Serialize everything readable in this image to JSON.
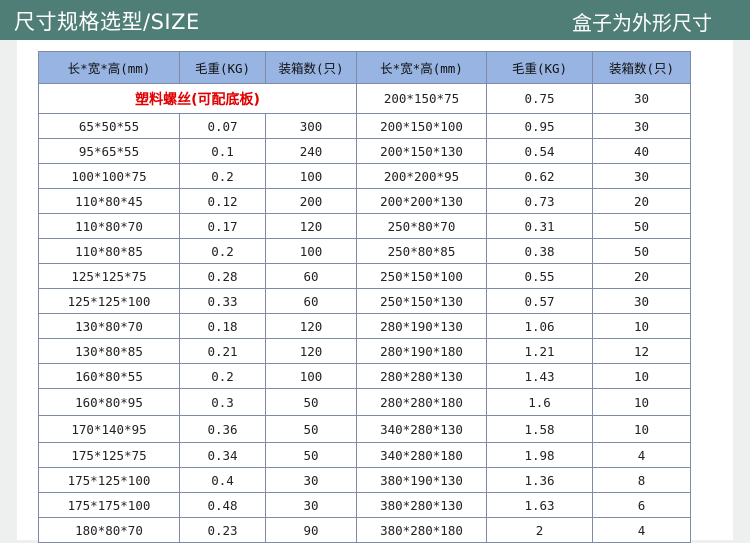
{
  "header": {
    "title_left": "尺寸规格选型/SIZE",
    "title_right": "盒子为外形尺寸"
  },
  "table": {
    "headers": [
      "长*宽*高(mm)",
      "毛重(KG)",
      "装箱数(只)",
      "长*宽*高(mm)",
      "毛重(KG)",
      "装箱数(只)"
    ],
    "plastic_note": "塑料螺丝(可配底板)",
    "first_right": [
      "200*150*75",
      "0.75",
      "30"
    ],
    "rows": [
      [
        "65*50*55",
        "0.07",
        "300",
        "200*150*100",
        "0.95",
        "30"
      ],
      [
        "95*65*55",
        "0.1",
        "240",
        "200*150*130",
        "0.54",
        "40"
      ],
      [
        "100*100*75",
        "0.2",
        "100",
        "200*200*95",
        "0.62",
        "30"
      ],
      [
        "110*80*45",
        "0.12",
        "200",
        "200*200*130",
        "0.73",
        "20"
      ],
      [
        "110*80*70",
        "0.17",
        "120",
        "250*80*70",
        "0.31",
        "50"
      ],
      [
        "110*80*85",
        "0.2",
        "100",
        "250*80*85",
        "0.38",
        "50"
      ],
      [
        "125*125*75",
        "0.28",
        "60",
        "250*150*100",
        "0.55",
        "20"
      ],
      [
        "125*125*100",
        "0.33",
        "60",
        "250*150*130",
        "0.57",
        "30"
      ],
      [
        "130*80*70",
        "0.18",
        "120",
        "280*190*130",
        "1.06",
        "10"
      ],
      [
        "130*80*85",
        "0.21",
        "120",
        "280*190*180",
        "1.21",
        "12"
      ],
      [
        "160*80*55",
        "0.2",
        "100",
        "280*280*130",
        "1.43",
        "10"
      ],
      [
        "160*80*95",
        "0.3",
        "50",
        "280*280*180",
        "1.6",
        "10"
      ],
      [
        "170*140*95",
        "0.36",
        "50",
        "340*280*130",
        "1.58",
        "10"
      ],
      [
        "175*125*75",
        "0.34",
        "50",
        "340*280*180",
        "1.98",
        "4"
      ],
      [
        "175*125*100",
        "0.4",
        "30",
        "380*190*130",
        "1.36",
        "8"
      ],
      [
        "175*175*100",
        "0.48",
        "30",
        "380*280*130",
        "1.63",
        "6"
      ],
      [
        "180*80*70",
        "0.23",
        "90",
        "380*280*180",
        "2",
        "4"
      ]
    ]
  },
  "colors": {
    "header_bar": "#4f7e77",
    "table_header": "#98b4e2",
    "highlight_text": "#e00000"
  }
}
